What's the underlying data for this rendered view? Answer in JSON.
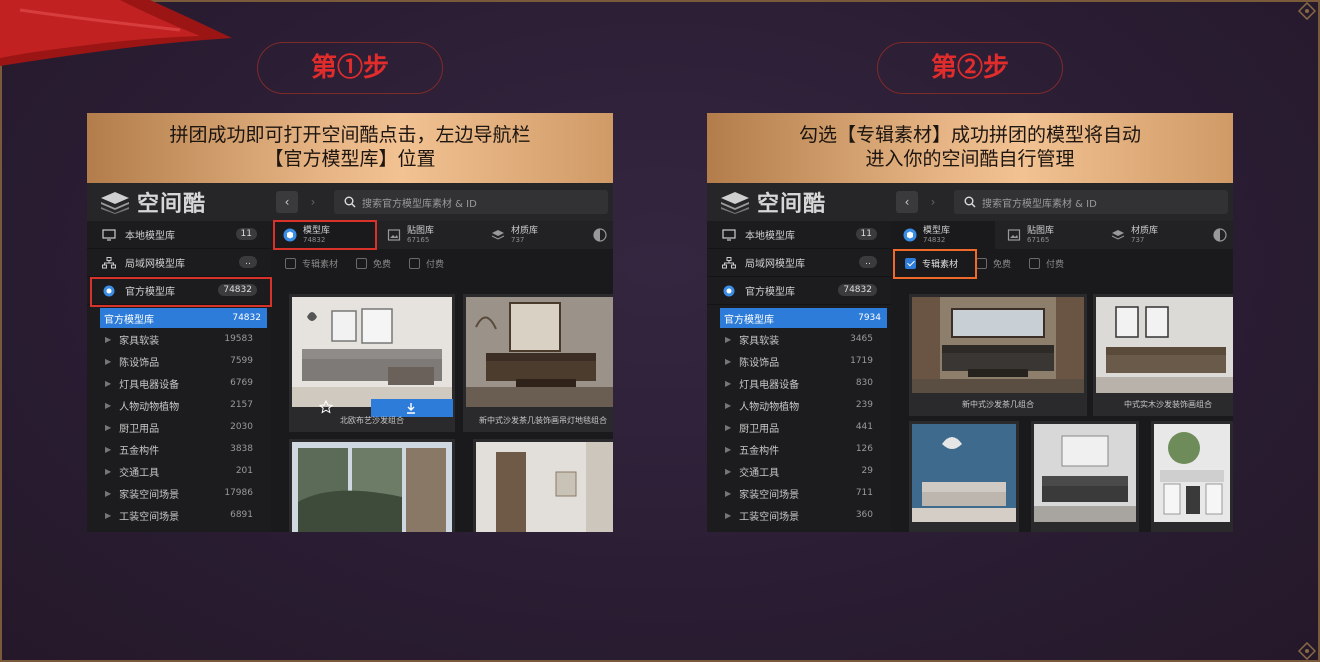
{
  "steps": [
    {
      "label": "第①步",
      "banner_lines": [
        "拼团成功即可打开空间酷点击，左边导航栏",
        "【官方模型库】位置"
      ],
      "app": {
        "logo_text": "空间酷",
        "back": "‹",
        "forward": "›",
        "search_placeholder": "搜索官方模型库素材 & ID",
        "top_items": [
          {
            "label": "本地模型库",
            "count": "11"
          },
          {
            "label": "局域网模型库",
            "count": ".."
          },
          {
            "label": "官方模型库",
            "count": "74832"
          }
        ],
        "active_item": {
          "label": "官方模型库",
          "count": "74832"
        },
        "categories": [
          {
            "label": "家具软装",
            "count": "19583"
          },
          {
            "label": "陈设饰品",
            "count": "7599"
          },
          {
            "label": "灯具电器设备",
            "count": "6769"
          },
          {
            "label": "人物动物植物",
            "count": "2157"
          },
          {
            "label": "厨卫用品",
            "count": "2030"
          },
          {
            "label": "五金构件",
            "count": "3838"
          },
          {
            "label": "交通工具",
            "count": "201"
          },
          {
            "label": "家装空间场景",
            "count": "17986"
          },
          {
            "label": "工装空间场景",
            "count": "6891"
          }
        ],
        "tabs": [
          {
            "label": "模型库",
            "count": "74832"
          },
          {
            "label": "贴图库",
            "count": "67165"
          },
          {
            "label": "材质库",
            "count": "737"
          }
        ],
        "filters": [
          {
            "label": "专辑素材",
            "checked": false
          },
          {
            "label": "免费",
            "checked": false
          },
          {
            "label": "付费",
            "checked": false
          }
        ],
        "cards": [
          {
            "caption": "北欧布艺沙发组合"
          },
          {
            "caption": "新中式沙发茶几装饰画吊灯地毯组合"
          }
        ]
      }
    },
    {
      "label": "第②步",
      "banner_lines": [
        "勾选【专辑素材】成功拼团的模型将自动",
        "进入你的空间酷自行管理"
      ],
      "app": {
        "logo_text": "空间酷",
        "back": "‹",
        "forward": "›",
        "search_placeholder": "搜索官方模型库素材 & ID",
        "top_items": [
          {
            "label": "本地模型库",
            "count": "11"
          },
          {
            "label": "局域网模型库",
            "count": ".."
          },
          {
            "label": "官方模型库",
            "count": "74832"
          }
        ],
        "active_item": {
          "label": "官方模型库",
          "count": "7934"
        },
        "categories": [
          {
            "label": "家具软装",
            "count": "3465"
          },
          {
            "label": "陈设饰品",
            "count": "1719"
          },
          {
            "label": "灯具电器设备",
            "count": "830"
          },
          {
            "label": "人物动物植物",
            "count": "239"
          },
          {
            "label": "厨卫用品",
            "count": "441"
          },
          {
            "label": "五金构件",
            "count": "126"
          },
          {
            "label": "交通工具",
            "count": "29"
          },
          {
            "label": "家装空间场景",
            "count": "711"
          },
          {
            "label": "工装空间场景",
            "count": "360"
          }
        ],
        "tabs": [
          {
            "label": "模型库",
            "count": "74832"
          },
          {
            "label": "贴图库",
            "count": "67165"
          },
          {
            "label": "材质库",
            "count": "737"
          }
        ],
        "filters": [
          {
            "label": "专辑素材",
            "checked": true
          },
          {
            "label": "免费",
            "checked": false
          },
          {
            "label": "付费",
            "checked": false
          }
        ],
        "cards": [
          {
            "caption": "新中式沙发茶几组合"
          },
          {
            "caption": "中式实木沙发装饰画组合"
          }
        ]
      }
    }
  ],
  "colors": {
    "accent": "#2d7cd9",
    "highlight": "#d8322b",
    "step_text": "#e12c2c"
  }
}
